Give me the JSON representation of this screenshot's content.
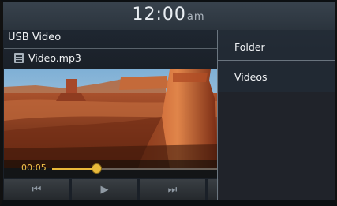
{
  "status_bar": {
    "time": "12:00",
    "ampm": "am"
  },
  "app": {
    "title": "USB Video"
  },
  "file": {
    "name": "Video.mp3",
    "icon": "file-list-icon"
  },
  "playback": {
    "elapsed": "00:05",
    "progress": 0.27
  },
  "controls": [
    {
      "name": "previous-button",
      "icon": "skip-previous-icon",
      "glyph": "⏮"
    },
    {
      "name": "play-button",
      "icon": "play-icon",
      "glyph": "▶"
    },
    {
      "name": "next-button",
      "icon": "skip-next-icon",
      "glyph": "⏭"
    }
  ],
  "menu": {
    "items": [
      {
        "label": "Folder"
      },
      {
        "label": "Videos"
      }
    ]
  },
  "colors": {
    "accent": "#e8b93a",
    "time_text": "#f2c24a",
    "panel": "#2b343d"
  }
}
